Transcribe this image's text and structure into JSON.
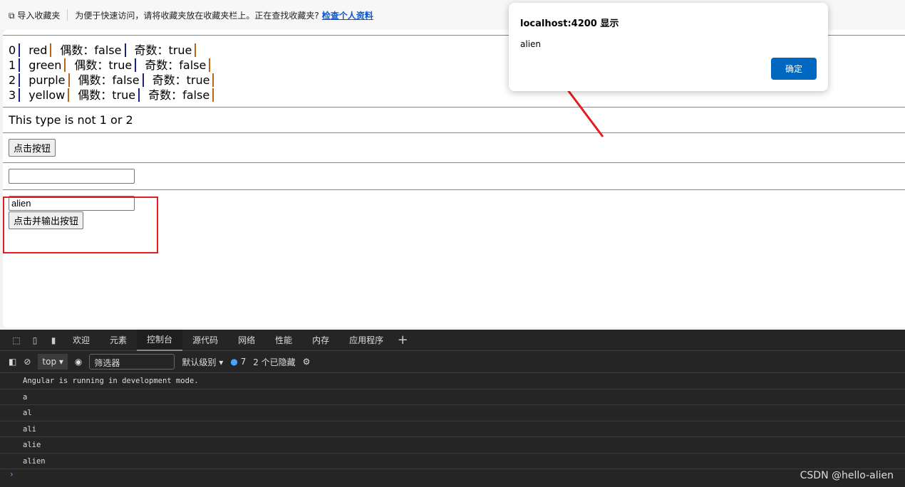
{
  "favbar": {
    "import": "导入收藏夹",
    "hint": "为便于快速访问，请将收藏夹放在收藏夹栏上。正在查找收藏夹?",
    "link": "检查个人资料"
  },
  "list": [
    {
      "i": "0",
      "color": "red",
      "even": "偶数：false",
      "odd": "奇数：true"
    },
    {
      "i": "1",
      "color": "green",
      "even": "偶数：true",
      "odd": "奇数：false"
    },
    {
      "i": "2",
      "color": "purple",
      "even": "偶数：false",
      "odd": "奇数：true"
    },
    {
      "i": "3",
      "color": "yellow",
      "even": "偶数：true",
      "odd": "奇数：false"
    }
  ],
  "type_text": "This type is not 1 or 2",
  "click_button": "点击按钮",
  "input2_value": "alien",
  "output_button": "点击并输出按钮",
  "dialog": {
    "title": "localhost:4200 显示",
    "message": "alien",
    "ok": "确定"
  },
  "devtools": {
    "tabs": [
      "欢迎",
      "元素",
      "控制台",
      "源代码",
      "网络",
      "性能",
      "内存",
      "应用程序"
    ],
    "active_tab": "控制台",
    "context": "top",
    "filter_placeholder": "筛选器",
    "level": "默认级别 ▾",
    "issues": "7",
    "hidden": "2 个已隐藏",
    "logs": [
      "Angular is running in development mode.",
      "a",
      "al",
      "ali",
      "alie",
      "alien"
    ]
  },
  "watermark": "CSDN @hello-alien"
}
